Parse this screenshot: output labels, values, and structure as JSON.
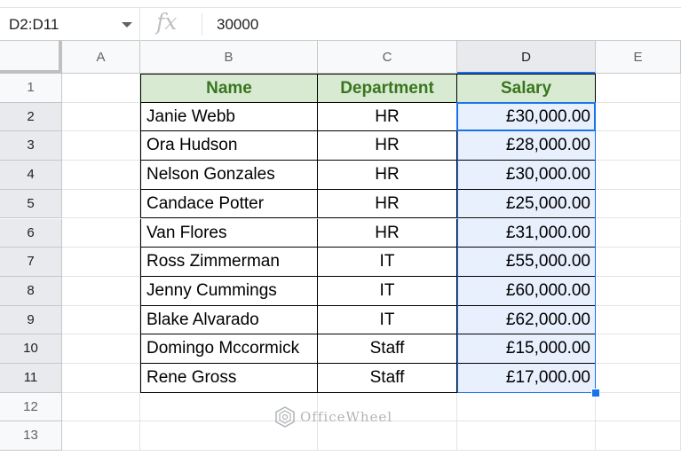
{
  "formula_bar": {
    "name_box": "D2:D11",
    "fx": "fx",
    "formula": "30000"
  },
  "columns": [
    "A",
    "B",
    "C",
    "D",
    "E"
  ],
  "rows": [
    "1",
    "2",
    "3",
    "4",
    "5",
    "6",
    "7",
    "8",
    "9",
    "10",
    "11",
    "12",
    "13"
  ],
  "table": {
    "headers": [
      "Name",
      "Department",
      "Salary"
    ],
    "rows": [
      [
        "Janie Webb",
        "HR",
        "£30,000.00"
      ],
      [
        "Ora Hudson",
        "HR",
        "£28,000.00"
      ],
      [
        "Nelson Gonzales",
        "HR",
        "£30,000.00"
      ],
      [
        "Candace Potter",
        "HR",
        "£25,000.00"
      ],
      [
        "Van Flores",
        "HR",
        "£31,000.00"
      ],
      [
        "Ross Zimmerman",
        "IT",
        "£55,000.00"
      ],
      [
        "Jenny Cummings",
        "IT",
        "£60,000.00"
      ],
      [
        "Blake Alvarado",
        "IT",
        "£62,000.00"
      ],
      [
        "Domingo Mccormick",
        "Staff",
        "£15,000.00"
      ],
      [
        "Rene Gross",
        "Staff",
        "£17,000.00"
      ]
    ]
  },
  "watermark": "OfficeWheel",
  "colors": {
    "header_fill": "#d9ead3",
    "header_text": "#38761d",
    "selection": "#1a73e8",
    "selection_fill": "#e8f0fe"
  }
}
